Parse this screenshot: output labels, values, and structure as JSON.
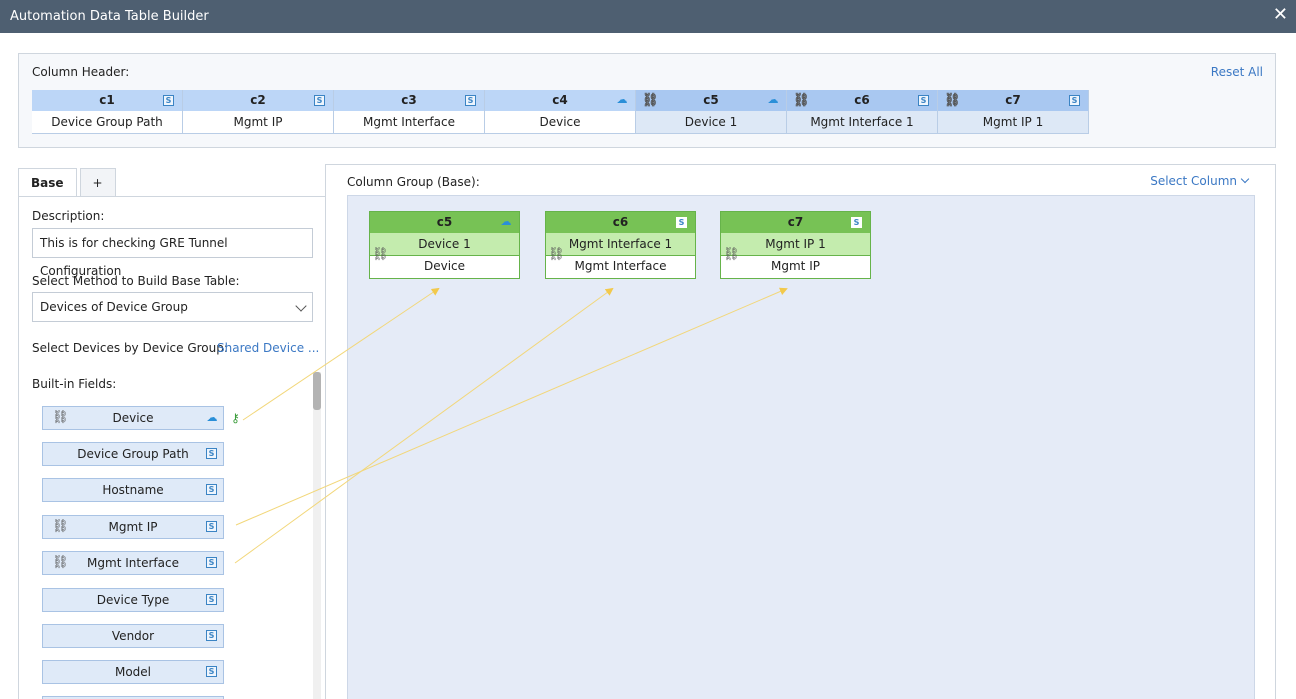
{
  "window": {
    "title": "Automation Data Table Builder",
    "close_glyph": "✕"
  },
  "column_header": {
    "label": "Column Header:",
    "reset_label": "Reset All",
    "columns": [
      {
        "id": "c1",
        "name": "Device Group Path",
        "icon": "s-icon"
      },
      {
        "id": "c2",
        "name": "Mgmt IP",
        "icon": "s-icon"
      },
      {
        "id": "c3",
        "name": "Mgmt Interface",
        "icon": "s-icon"
      },
      {
        "id": "c4",
        "name": "Device",
        "icon": "device-icon"
      },
      {
        "id": "c5",
        "name": "Device 1",
        "icon": "device-icon",
        "linked": true
      },
      {
        "id": "c6",
        "name": "Mgmt Interface 1",
        "icon": "s-icon",
        "linked": true
      },
      {
        "id": "c7",
        "name": "Mgmt IP 1",
        "icon": "s-icon",
        "linked": true
      }
    ]
  },
  "tabs": [
    {
      "label": "Base",
      "active": true
    },
    {
      "label": "+"
    }
  ],
  "base": {
    "description_label": "Description:",
    "description_value": "This is for checking GRE Tunnel Configuration",
    "method_label": "Select Method to Build Base Table:",
    "method_value": "Devices of Device Group",
    "device_group_label": "Select Devices by Device Group:",
    "device_group_link": "Shared Device ...",
    "builtin_label": "Built-in Fields:",
    "fields": [
      {
        "name": "Device",
        "icon": "device-icon",
        "linked": true,
        "key": true
      },
      {
        "name": "Device Group Path",
        "icon": "s-icon"
      },
      {
        "name": "Hostname",
        "icon": "s-icon"
      },
      {
        "name": "Mgmt IP",
        "icon": "s-icon",
        "linked": true
      },
      {
        "name": "Mgmt Interface",
        "icon": "s-icon",
        "linked": true
      },
      {
        "name": "Device Type",
        "icon": "s-icon"
      },
      {
        "name": "Vendor",
        "icon": "s-icon"
      },
      {
        "name": "Model",
        "icon": "s-icon"
      }
    ]
  },
  "column_group": {
    "title": "Column Group (Base):",
    "select_label": "Select Column",
    "nodes": [
      {
        "id": "c5",
        "display": "Device 1",
        "source": "Device",
        "icon": "device-icon"
      },
      {
        "id": "c6",
        "display": "Mgmt Interface 1",
        "source": "Mgmt Interface",
        "icon": "s-icon"
      },
      {
        "id": "c7",
        "display": "Mgmt IP 1",
        "source": "Mgmt IP",
        "icon": "s-icon"
      }
    ]
  },
  "icons": {
    "s-icon": "S",
    "device-icon": "☁",
    "link-icon": "⛓",
    "key-icon": "⚷"
  },
  "colors": {
    "accent": "#3b78c4",
    "header_blue": "#bcd6f7",
    "node_green": "#77c255",
    "arrow": "#f2c94c"
  }
}
